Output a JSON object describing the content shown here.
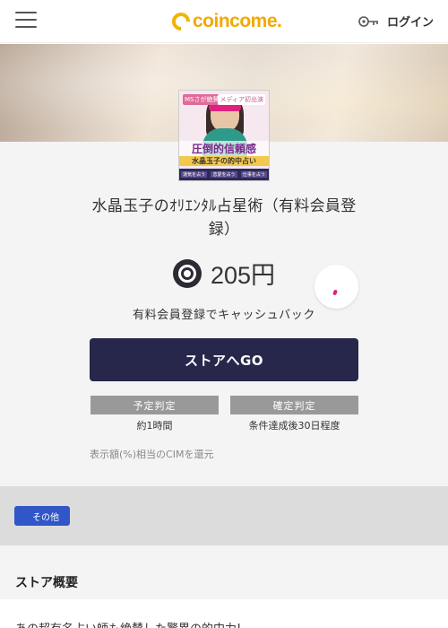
{
  "header": {
    "logo_text": "coincome.",
    "login_label": "ログイン",
    "menu_icon": "hamburger-menu-icon",
    "login_icon": "key-icon",
    "brand_color": "#f2a900"
  },
  "product": {
    "thumbnail": {
      "tag_left": "MSさが絶賛！",
      "tag_right": "メディア初出演",
      "headline": "圧倒的信頼感",
      "subline": "水晶玉子の的中占い",
      "strip": [
        "運気を占う",
        "恋愛を占う",
        "仕事を占う"
      ]
    },
    "title": "水晶玉子のｵﾘｴﾝﾀﾙ占星術（有料会員登録）",
    "price": "205円",
    "price_icon": "coin-icon",
    "favorite_icon": "heart-icon",
    "cashback_label": "有料会員登録でキャッシュバック",
    "go_button": "ストアへGO",
    "accent_color": "#26274a"
  },
  "judgement": {
    "pending_label": "予定判定",
    "pending_value": "約1時間",
    "confirmed_label": "確定判定",
    "confirmed_value": "条件達成後30日程度"
  },
  "note": "表示額(%)相当のCIMを還元",
  "category": {
    "label": "その他",
    "color": "#3156c8"
  },
  "overview": {
    "heading": "ストア概要",
    "description": "あの超有名占い師も絶賛した驚異の的中力!"
  }
}
